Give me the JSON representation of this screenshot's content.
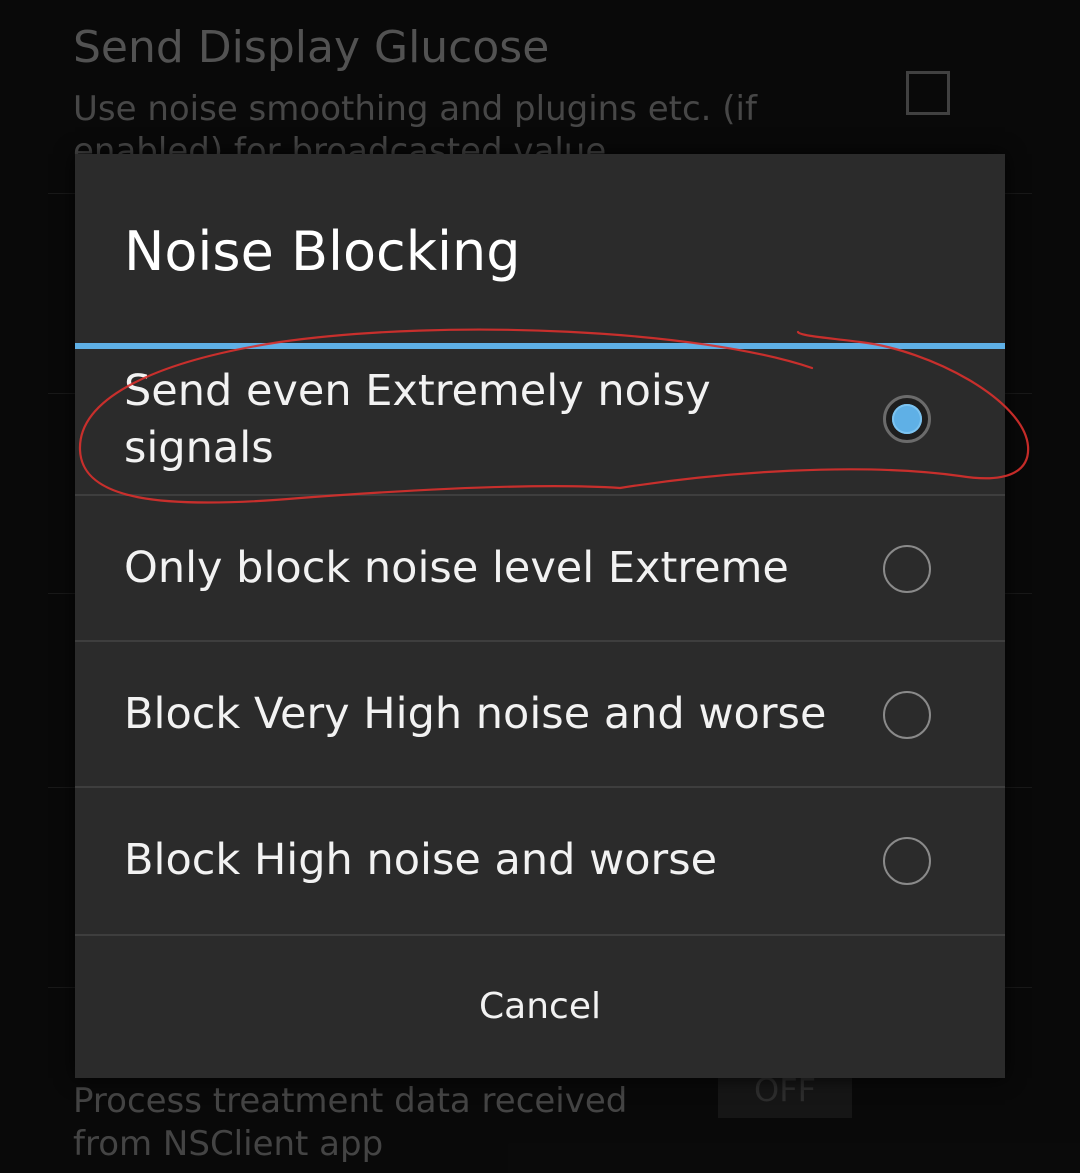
{
  "background": {
    "setting_title": "Send Display Glucose",
    "setting_summary": "Use noise smoothing and plugins etc. (if enabled) for broadcasted value",
    "bottom_summary": "Process treatment data received from NSClient app",
    "bottom_toggle_label": "OFF"
  },
  "dialog": {
    "title": "Noise Blocking",
    "options": [
      {
        "label": "Send even Extremely noisy signals",
        "selected": true
      },
      {
        "label": "Only block noise level Extreme",
        "selected": false
      },
      {
        "label": "Block Very High noise and worse",
        "selected": false
      },
      {
        "label": "Block High noise and worse",
        "selected": false
      }
    ],
    "cancel_label": "Cancel"
  },
  "colors": {
    "accent": "#5fb0e6",
    "dialog_bg": "#2b2b2b",
    "annotation": "#d9302c"
  }
}
